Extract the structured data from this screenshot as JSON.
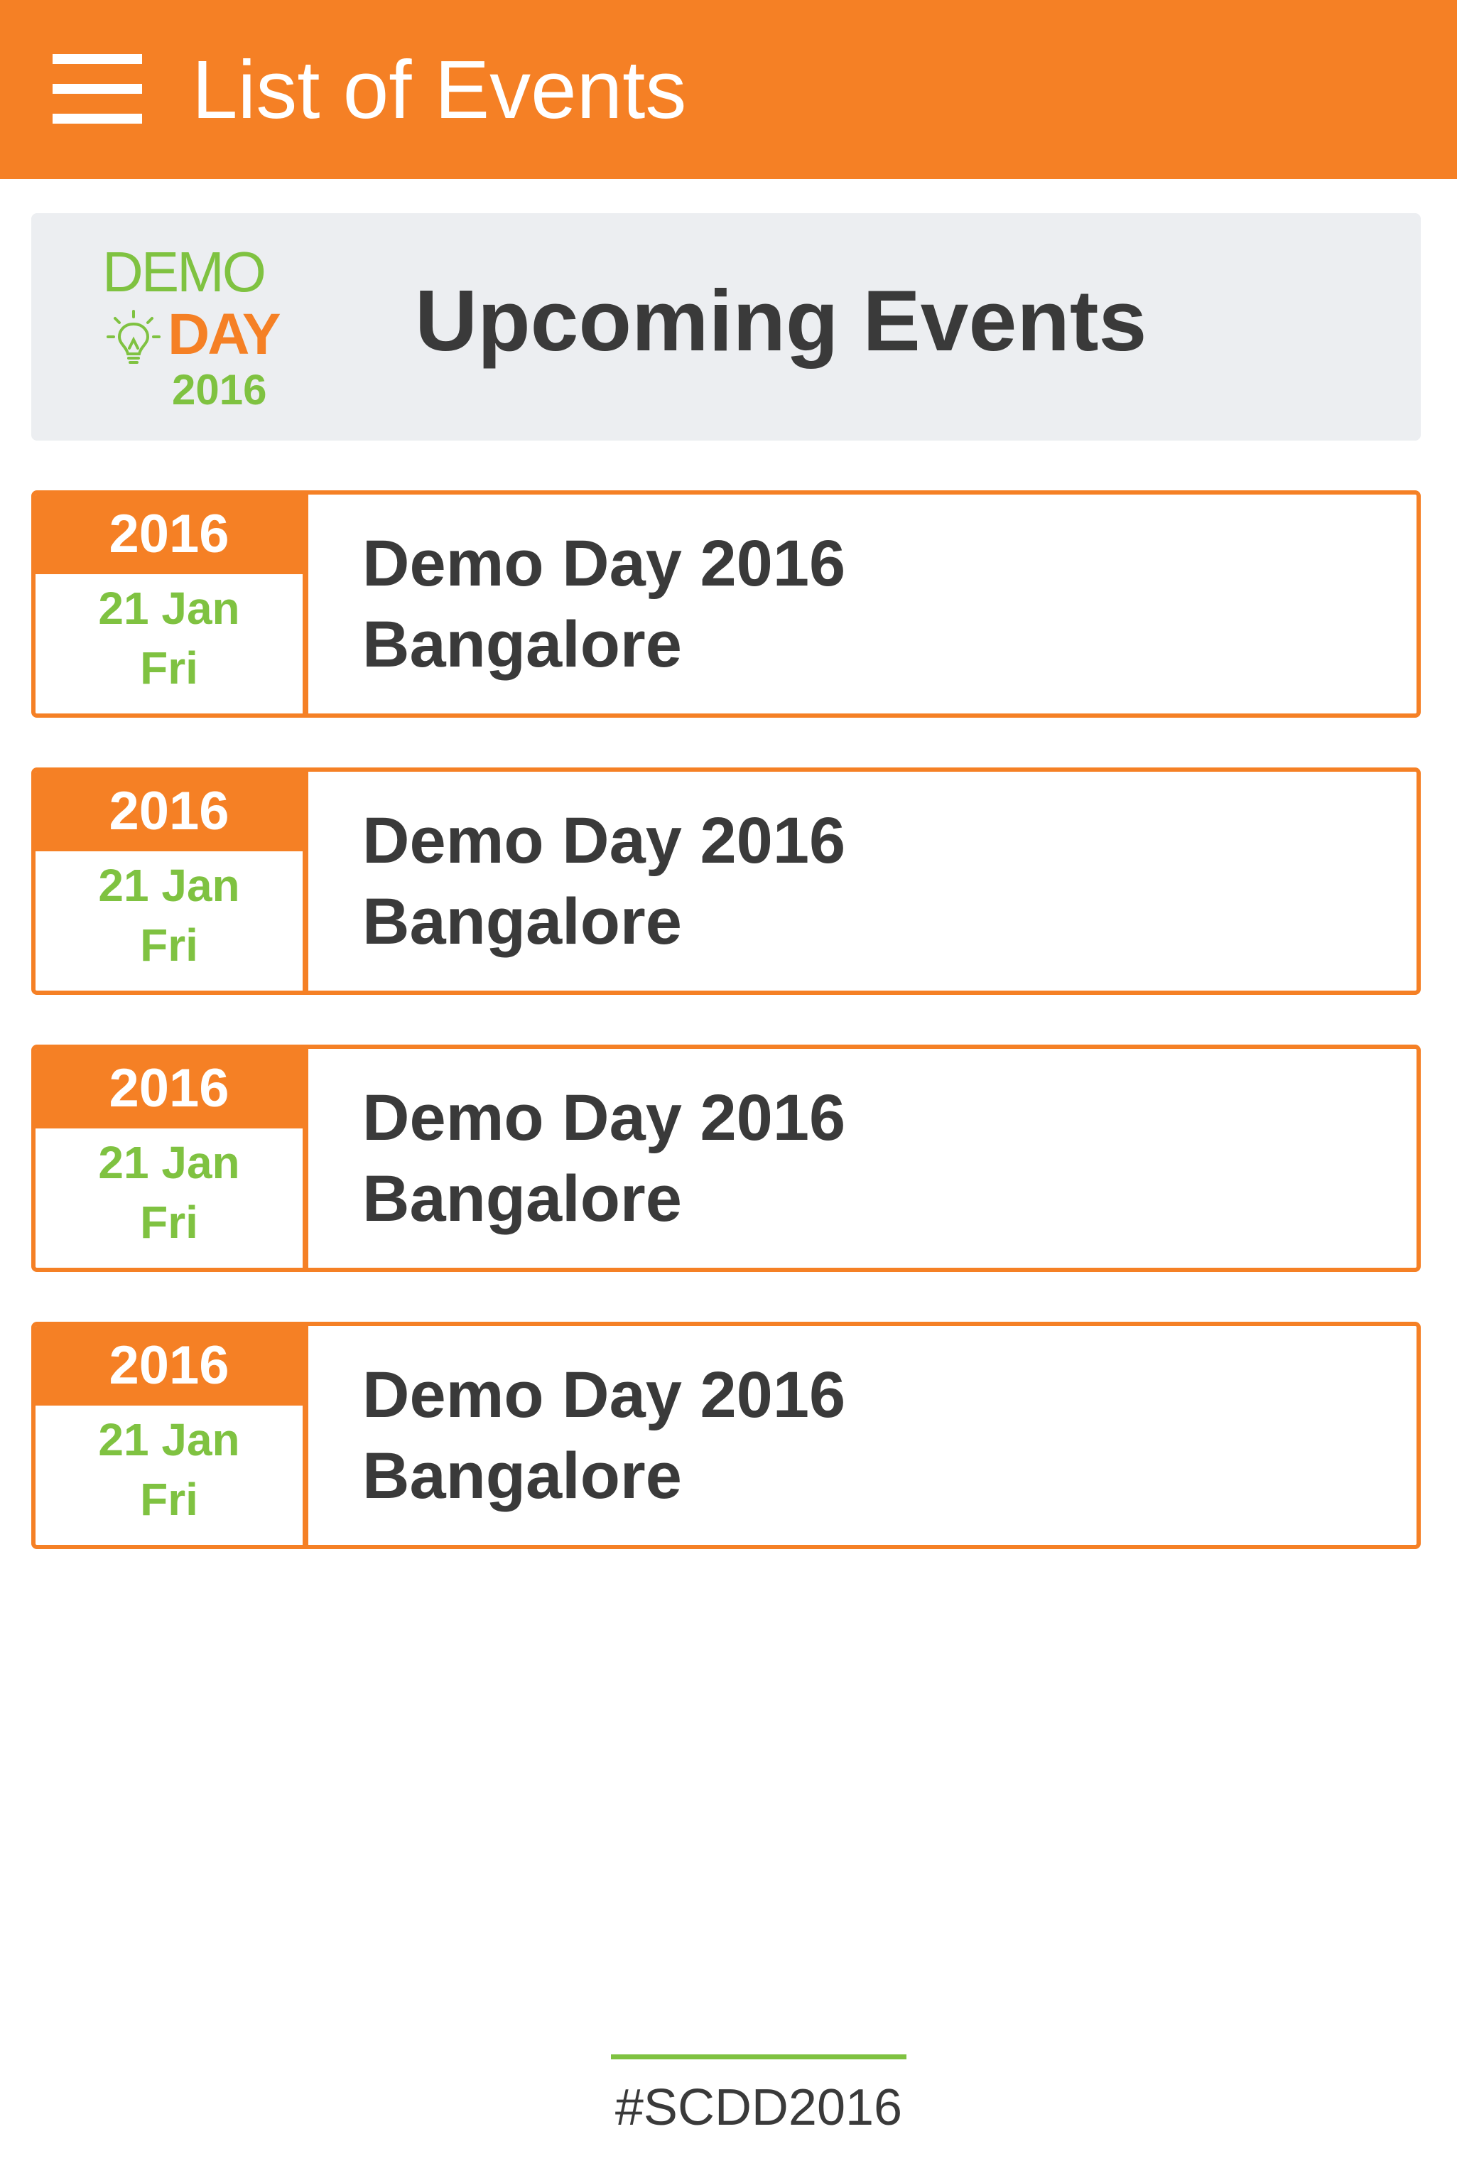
{
  "app_bar": {
    "title": "List of Events",
    "menu_icon": "hamburger-menu-icon",
    "background_color": "#f58025"
  },
  "banner": {
    "title": "Upcoming Events",
    "logo": {
      "line1": "DEMO",
      "line2": "DAY",
      "line3": "2016",
      "icon": "lightbulb-icon"
    }
  },
  "events": [
    {
      "year": "2016",
      "day": "21 Jan",
      "weekday": "Fri",
      "name": "Demo Day 2016",
      "city": "Bangalore"
    },
    {
      "year": "2016",
      "day": "21 Jan",
      "weekday": "Fri",
      "name": "Demo Day 2016",
      "city": "Bangalore"
    },
    {
      "year": "2016",
      "day": "21 Jan",
      "weekday": "Fri",
      "name": "Demo Day 2016",
      "city": "Bangalore"
    },
    {
      "year": "2016",
      "day": "21 Jan",
      "weekday": "Fri",
      "name": "Demo Day 2016",
      "city": "Bangalore"
    }
  ],
  "footer": {
    "hashtag": "#SCDD2016"
  },
  "colors": {
    "accent_orange": "#f58025",
    "accent_green": "#7fc241",
    "text_dark": "#3a3a3a",
    "banner_bg": "#eceef1"
  }
}
